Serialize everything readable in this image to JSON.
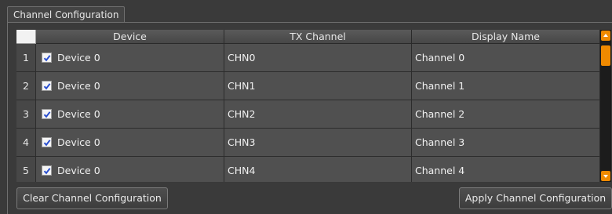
{
  "group": {
    "title": "Channel Configuration"
  },
  "table": {
    "columns": [
      "Device",
      "TX Channel",
      "Display Name"
    ],
    "rows": [
      {
        "num": "1",
        "checked": true,
        "device": "Device 0",
        "tx": "CHN0",
        "display": "Channel 0"
      },
      {
        "num": "2",
        "checked": true,
        "device": "Device 0",
        "tx": "CHN1",
        "display": "Channel 1"
      },
      {
        "num": "3",
        "checked": true,
        "device": "Device 0",
        "tx": "CHN2",
        "display": "Channel 2"
      },
      {
        "num": "4",
        "checked": true,
        "device": "Device 0",
        "tx": "CHN3",
        "display": "Channel 3"
      },
      {
        "num": "5",
        "checked": true,
        "device": "Device 0",
        "tx": "CHN4",
        "display": "Channel 4"
      }
    ]
  },
  "buttons": {
    "clear": "Clear Channel Configuration",
    "apply": "Apply Channel Configuration"
  },
  "colors": {
    "accent": "#f08a00",
    "checkbox_check": "#2a4fd0"
  },
  "icons": {
    "scroll_up": "arrow-up-icon",
    "scroll_down": "arrow-down-icon",
    "checkbox": "checkmark-icon"
  }
}
